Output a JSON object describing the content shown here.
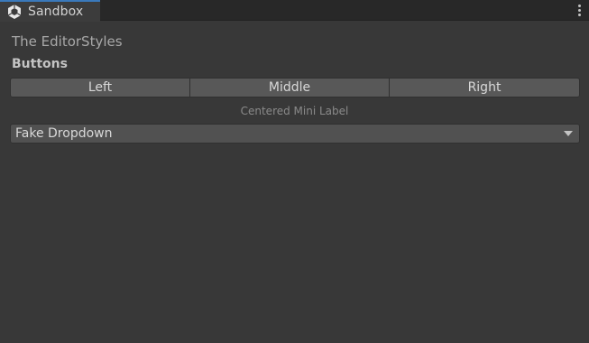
{
  "window": {
    "tab_title": "Sandbox",
    "tab_icon": "unity-logo-icon",
    "menu_icon": "kebab-menu-icon"
  },
  "content": {
    "heading": "The EditorStyles",
    "buttons_label": "Buttons",
    "buttons": [
      {
        "label": "Left"
      },
      {
        "label": "Middle"
      },
      {
        "label": "Right"
      }
    ],
    "mini_label": "Centered Mini Label",
    "dropdown": {
      "value": "Fake Dropdown",
      "icon": "dropdown-arrow-icon"
    }
  },
  "colors": {
    "background": "#383838",
    "tab_accent": "#3a79bb",
    "button_bg": "#585858"
  }
}
